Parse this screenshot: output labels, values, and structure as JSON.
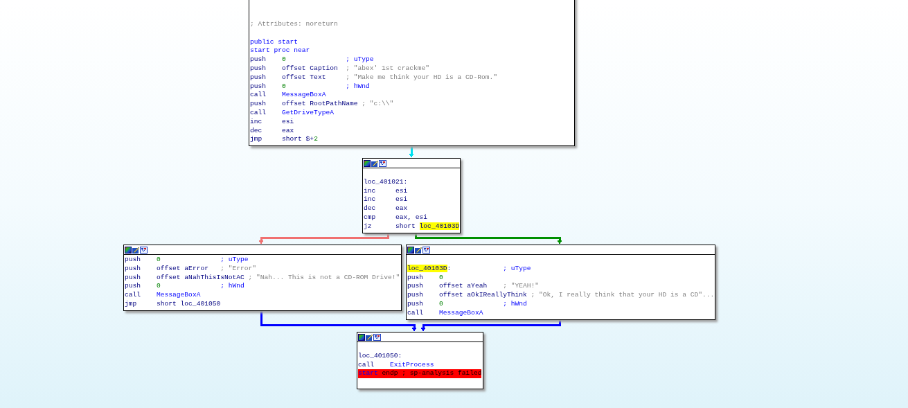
{
  "nodes": [
    {
      "lines": [
        {
          "kind": "code",
          "segments": [
            {
              "text": "; Attributes: noreturn",
              "kind": "str"
            }
          ]
        },
        {
          "kind": "code",
          "segments": [
            {
              "text": "public start",
              "kind": "sym"
            }
          ]
        },
        {
          "kind": "code",
          "segments": [
            {
              "text": "start proc near",
              "kind": "sym"
            }
          ]
        },
        {
          "kind": "code",
          "segments": [
            {
              "text": "push    ",
              "kind": "ins"
            },
            {
              "text": "0",
              "kind": "num"
            },
            {
              "text": "               ; uType",
              "kind": "sym"
            }
          ]
        },
        {
          "kind": "code",
          "segments": [
            {
              "text": "push    ",
              "kind": "ins"
            },
            {
              "text": "offset Caption",
              "kind": "ins"
            },
            {
              "text": "  ; \"abex' 1st crackme\"",
              "kind": "str"
            }
          ]
        },
        {
          "kind": "code",
          "segments": [
            {
              "text": "push    ",
              "kind": "ins"
            },
            {
              "text": "offset Text",
              "kind": "ins"
            },
            {
              "text": "     ; \"Make me think your HD is a CD-Rom.\"",
              "kind": "str"
            }
          ]
        },
        {
          "kind": "code",
          "segments": [
            {
              "text": "push    ",
              "kind": "ins"
            },
            {
              "text": "0",
              "kind": "num"
            },
            {
              "text": "               ; hWnd",
              "kind": "sym"
            }
          ]
        },
        {
          "kind": "code",
          "segments": [
            {
              "text": "call    ",
              "kind": "ins"
            },
            {
              "text": "MessageBoxA",
              "kind": "sym"
            }
          ]
        },
        {
          "kind": "code",
          "segments": [
            {
              "text": "push    ",
              "kind": "ins"
            },
            {
              "text": "offset RootPathName",
              "kind": "ins"
            },
            {
              "text": " ; \"c:\\\\\"",
              "kind": "str"
            }
          ]
        },
        {
          "kind": "code",
          "segments": [
            {
              "text": "call    ",
              "kind": "ins"
            },
            {
              "text": "GetDriveTypeA",
              "kind": "sym"
            }
          ]
        },
        {
          "kind": "code",
          "segments": [
            {
              "text": "inc     esi",
              "kind": "ins"
            }
          ]
        },
        {
          "kind": "code",
          "segments": [
            {
              "text": "dec     eax",
              "kind": "ins"
            }
          ]
        },
        {
          "kind": "code",
          "segments": [
            {
              "text": "jmp     short $+",
              "kind": "ins"
            },
            {
              "text": "2",
              "kind": "num"
            }
          ]
        }
      ]
    },
    {
      "lines": [
        {
          "kind": "code",
          "segments": [
            {
              "text": "loc_401021:",
              "kind": "ins"
            }
          ]
        },
        {
          "kind": "code",
          "segments": [
            {
              "text": "inc     esi",
              "kind": "ins"
            }
          ]
        },
        {
          "kind": "code",
          "segments": [
            {
              "text": "inc     esi",
              "kind": "ins"
            }
          ]
        },
        {
          "kind": "code",
          "segments": [
            {
              "text": "dec     eax",
              "kind": "ins"
            }
          ]
        },
        {
          "kind": "code",
          "segments": [
            {
              "text": "cmp     eax, esi",
              "kind": "ins"
            }
          ]
        },
        {
          "kind": "code",
          "segments": [
            {
              "text": "jz      short ",
              "kind": "ins"
            },
            {
              "text": "loc_40103D",
              "kind": "hl"
            }
          ]
        }
      ]
    },
    {
      "lines": [
        {
          "kind": "code",
          "segments": [
            {
              "text": "push    ",
              "kind": "ins"
            },
            {
              "text": "0",
              "kind": "num"
            },
            {
              "text": "               ; uType",
              "kind": "sym"
            }
          ]
        },
        {
          "kind": "code",
          "segments": [
            {
              "text": "push    ",
              "kind": "ins"
            },
            {
              "text": "offset aError",
              "kind": "ins"
            },
            {
              "text": "   ; \"Error\"",
              "kind": "str"
            }
          ]
        },
        {
          "kind": "code",
          "segments": [
            {
              "text": "push    ",
              "kind": "ins"
            },
            {
              "text": "offset aNahThisIsNotAC",
              "kind": "ins"
            },
            {
              "text": " ; \"Nah... This is not a CD-ROM Drive!\"",
              "kind": "str"
            }
          ]
        },
        {
          "kind": "code",
          "segments": [
            {
              "text": "push    ",
              "kind": "ins"
            },
            {
              "text": "0",
              "kind": "num"
            },
            {
              "text": "               ; hWnd",
              "kind": "sym"
            }
          ]
        },
        {
          "kind": "code",
          "segments": [
            {
              "text": "call    ",
              "kind": "ins"
            },
            {
              "text": "MessageBoxA",
              "kind": "sym"
            }
          ]
        },
        {
          "kind": "code",
          "segments": [
            {
              "text": "jmp     short loc_401050",
              "kind": "ins"
            }
          ]
        }
      ]
    },
    {
      "lines": [
        {
          "kind": "code",
          "segments": [
            {
              "text": "loc_40103D",
              "kind": "hl"
            },
            {
              "text": ":",
              "kind": "ins"
            },
            {
              "text": "             ; uType",
              "kind": "sym"
            }
          ]
        },
        {
          "kind": "code",
          "segments": [
            {
              "text": "push    ",
              "kind": "ins"
            },
            {
              "text": "0",
              "kind": "num"
            }
          ]
        },
        {
          "kind": "code",
          "segments": [
            {
              "text": "push    ",
              "kind": "ins"
            },
            {
              "text": "offset aYeah",
              "kind": "ins"
            },
            {
              "text": "    ; \"YEAH!\"",
              "kind": "str"
            }
          ]
        },
        {
          "kind": "code",
          "segments": [
            {
              "text": "push    ",
              "kind": "ins"
            },
            {
              "text": "offset aOkIReallyThink",
              "kind": "ins"
            },
            {
              "text": " ; \"Ok, I really think that your HD is a CD\"...",
              "kind": "str"
            }
          ]
        },
        {
          "kind": "code",
          "segments": [
            {
              "text": "push    ",
              "kind": "ins"
            },
            {
              "text": "0",
              "kind": "num"
            },
            {
              "text": "               ; hWnd",
              "kind": "sym"
            }
          ]
        },
        {
          "kind": "code",
          "segments": [
            {
              "text": "call    ",
              "kind": "ins"
            },
            {
              "text": "MessageBoxA",
              "kind": "sym"
            }
          ]
        }
      ]
    },
    {
      "lines": [
        {
          "kind": "code",
          "segments": [
            {
              "text": "loc_401050:",
              "kind": "ins"
            }
          ]
        },
        {
          "kind": "code",
          "segments": [
            {
              "text": "call    ",
              "kind": "ins"
            },
            {
              "text": "ExitProcess",
              "kind": "sym"
            }
          ]
        },
        {
          "kind": "error",
          "segments": [
            {
              "text": "start",
              "kind": "sym"
            },
            {
              "text": " endp ; sp-analysis failed",
              "kind": "plain"
            }
          ]
        }
      ]
    }
  ],
  "edges": [
    {
      "color": "#00e0f0"
    },
    {
      "color": "#f07070"
    },
    {
      "color": "#009000"
    },
    {
      "color": "#0000ff"
    },
    {
      "color": "#0000ff"
    }
  ]
}
